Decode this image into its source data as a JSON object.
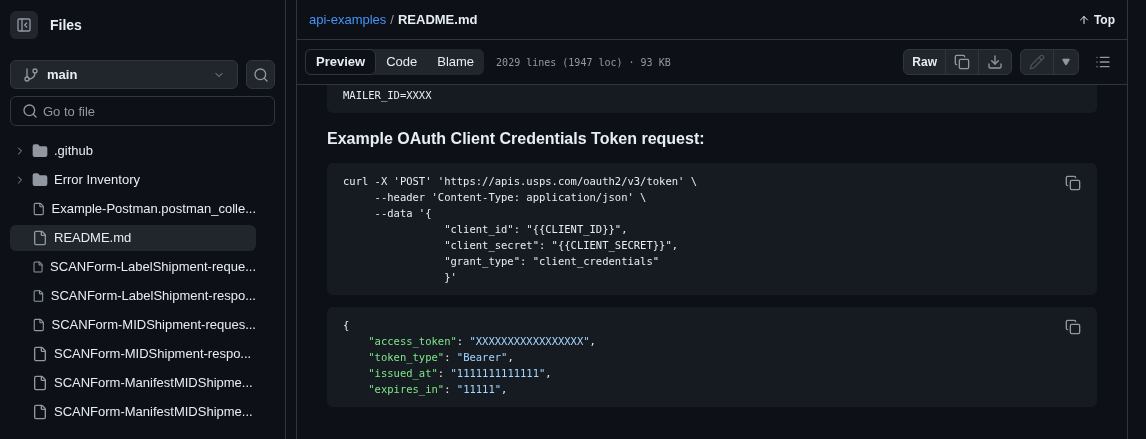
{
  "sidebar": {
    "title": "Files",
    "branch": "main",
    "search": {
      "placeholder": "Go to file"
    },
    "items": [
      {
        "kind": "folder",
        "name": ".github",
        "selected": false,
        "expanded": false
      },
      {
        "kind": "folder",
        "name": "Error Inventory",
        "selected": false,
        "expanded": false
      },
      {
        "kind": "file",
        "name": "Example-Postman.postman_colle...",
        "selected": false
      },
      {
        "kind": "file",
        "name": "README.md",
        "selected": true
      },
      {
        "kind": "file",
        "name": "SCANForm-LabelShipment-reque...",
        "selected": false
      },
      {
        "kind": "file",
        "name": "SCANForm-LabelShipment-respo...",
        "selected": false
      },
      {
        "kind": "file",
        "name": "SCANForm-MIDShipment-reques...",
        "selected": false
      },
      {
        "kind": "file",
        "name": "SCANForm-MIDShipment-respo...",
        "selected": false
      },
      {
        "kind": "file",
        "name": "SCANForm-ManifestMIDShipme...",
        "selected": false
      },
      {
        "kind": "file",
        "name": "SCANForm-ManifestMIDShipme...",
        "selected": false
      }
    ]
  },
  "breadcrumb": {
    "repo": "api-examples",
    "separator": "/",
    "file": "README.md"
  },
  "top_link": "Top",
  "tabs": [
    {
      "label": "Preview",
      "selected": true
    },
    {
      "label": "Code",
      "selected": false
    },
    {
      "label": "Blame",
      "selected": false
    }
  ],
  "file_info": "2029 lines (1947 loc) · 93 KB",
  "raw_button": "Raw",
  "content": [
    {
      "kind": "code",
      "lines": [
        [
          {
            "t": "MAILER_ID=XXXX",
            "kind": "plain"
          }
        ]
      ]
    },
    {
      "kind": "heading",
      "text": "Example OAuth Client Credentials Token request:"
    },
    {
      "kind": "code",
      "copy": true,
      "lines": [
        [
          {
            "t": "curl -X 'POST' 'https://apis.usps.com/oauth2/v3/token' \\",
            "kind": "plain"
          }
        ],
        [
          {
            "t": "     --header 'Content-Type: application/json' \\",
            "kind": "plain"
          }
        ],
        [
          {
            "t": "     --data '{",
            "kind": "plain"
          }
        ],
        [
          {
            "t": "                \"client_id\": \"{{CLIENT_ID}}\",",
            "kind": "plain"
          }
        ],
        [
          {
            "t": "                \"client_secret\": \"{{CLIENT_SECRET}}\",",
            "kind": "plain"
          }
        ],
        [
          {
            "t": "                \"grant_type\": \"client_credentials\"",
            "kind": "plain"
          }
        ],
        [
          {
            "t": "                }'",
            "kind": "plain"
          }
        ]
      ]
    },
    {
      "kind": "code",
      "copy": true,
      "lines": [
        [
          {
            "t": "{",
            "kind": "plain"
          }
        ],
        [
          {
            "t": "    \"access_token\"",
            "kind": "key"
          },
          {
            "t": ": ",
            "kind": "plain"
          },
          {
            "t": "\"XXXXXXXXXXXXXXXXX\"",
            "kind": "string"
          },
          {
            "t": ",",
            "kind": "plain"
          }
        ],
        [
          {
            "t": "    \"token_type\"",
            "kind": "key"
          },
          {
            "t": ": ",
            "kind": "plain"
          },
          {
            "t": "\"Bearer\"",
            "kind": "string"
          },
          {
            "t": ",",
            "kind": "plain"
          }
        ],
        [
          {
            "t": "    \"issued_at\"",
            "kind": "key"
          },
          {
            "t": ": ",
            "kind": "plain"
          },
          {
            "t": "\"1111111111111\"",
            "kind": "string"
          },
          {
            "t": ",",
            "kind": "plain"
          }
        ],
        [
          {
            "t": "    \"expires_in\"",
            "kind": "key"
          },
          {
            "t": ": ",
            "kind": "plain"
          },
          {
            "t": "\"11111\"",
            "kind": "string"
          },
          {
            "t": ",",
            "kind": "plain"
          }
        ]
      ]
    }
  ]
}
